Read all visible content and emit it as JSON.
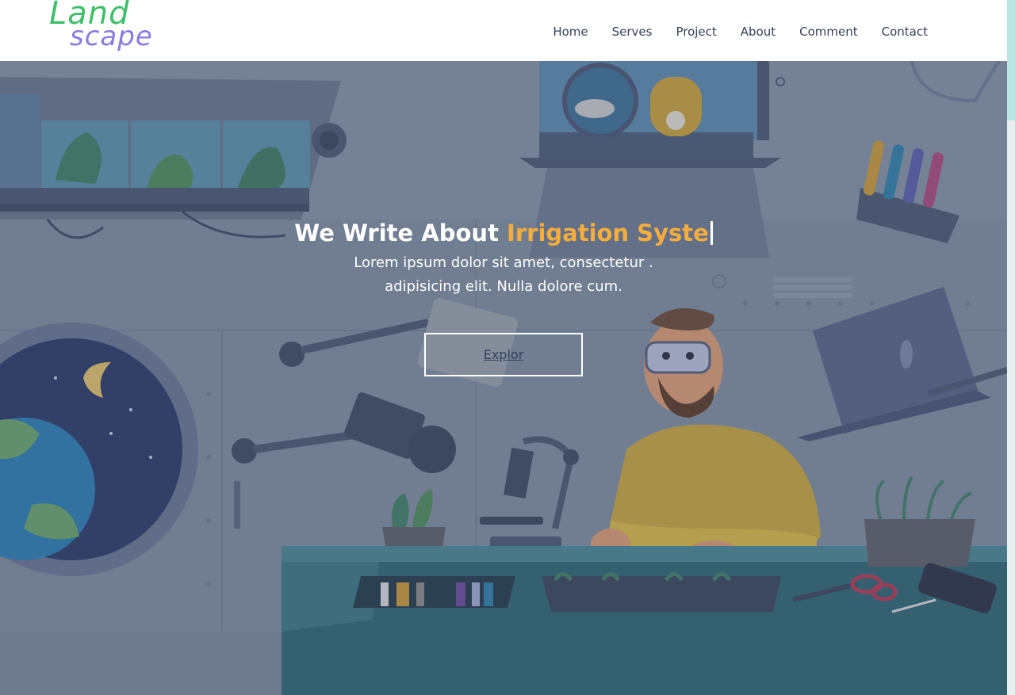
{
  "logo": {
    "line1": "Land",
    "line2": "scape"
  },
  "nav": {
    "items": [
      "Home",
      "Serves",
      "Project",
      "About",
      "Comment",
      "Contact"
    ]
  },
  "hero": {
    "title_prefix": "We Write About",
    "title_typed": "Irrigation Syste",
    "subtitle_line1": "Lorem ipsum dolor sit amet, consectetur .",
    "subtitle_line2": "adipisicing elit. Nulla dolore cum.",
    "button_label": "Explor"
  },
  "colors": {
    "accent": "#f5ad3d",
    "logo_green": "#3fbf6a",
    "logo_purple": "#8a7be0",
    "nav_text": "#33415c"
  },
  "icons": [
    "menu-scrollbar",
    "illustration-lab-scene"
  ]
}
